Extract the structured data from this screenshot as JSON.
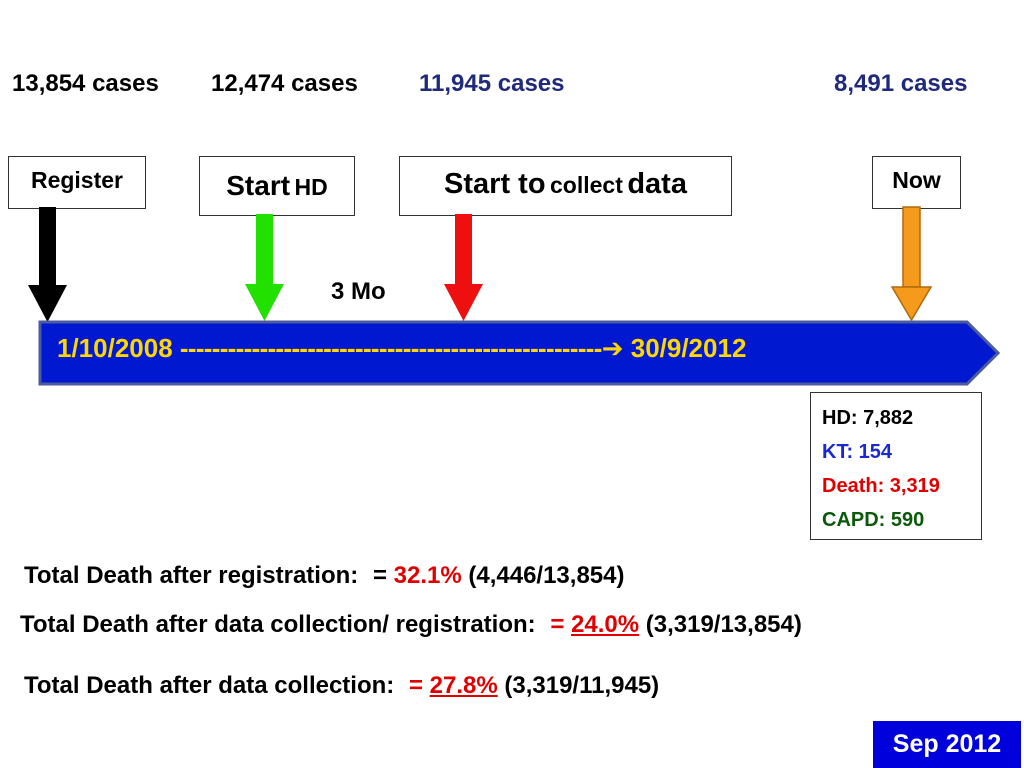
{
  "cases": {
    "register": "13,854 cases",
    "start_hd": "12,474 cases",
    "start_collect": "11,945 cases",
    "now": "8,491 cases"
  },
  "milestones": {
    "register": "Register",
    "start_hd_main": "Start",
    "start_hd_sub": "HD",
    "collect_a": "Start to",
    "collect_b": "collect",
    "collect_c": "data",
    "now": "Now"
  },
  "interval_label": "3 Mo",
  "timeline": {
    "start": "1/10/2008",
    "dashes": "-----------------------------------------------------",
    "arrow": "➔",
    "end": "30/9/2012"
  },
  "outcomes": {
    "hd": "HD: 7,882",
    "kt": "KT: 154",
    "death": "Death: 3,319",
    "capd": "CAPD: 590"
  },
  "stats": [
    {
      "label": "Total Death after registration:",
      "eq": "=",
      "pct": "32.1%",
      "ratio": "(4,446/13,854)"
    },
    {
      "label": "Total Death after data collection/ registration:",
      "eq": "=",
      "pct": "24.0%",
      "ratio": "(3,319/13,854)"
    },
    {
      "label": "Total Death after data collection:",
      "eq": "=",
      "pct": "27.8%",
      "ratio": "(3,319/11,945)"
    }
  ],
  "date_badge": "Sep 2012",
  "colors": {
    "cases_black": "#000000",
    "cases_navy": "#1f2a7a",
    "timeline_fill": "#0018d0",
    "timeline_text": "#ffd700",
    "arrow_register": "#000000",
    "arrow_hd": "#22e000",
    "arrow_collect": "#ee1010",
    "arrow_now": "#f59a1a",
    "kt": "#1a2ad0",
    "death": "#e00000",
    "capd": "#0a5a0a",
    "badge": "#0000dd"
  }
}
